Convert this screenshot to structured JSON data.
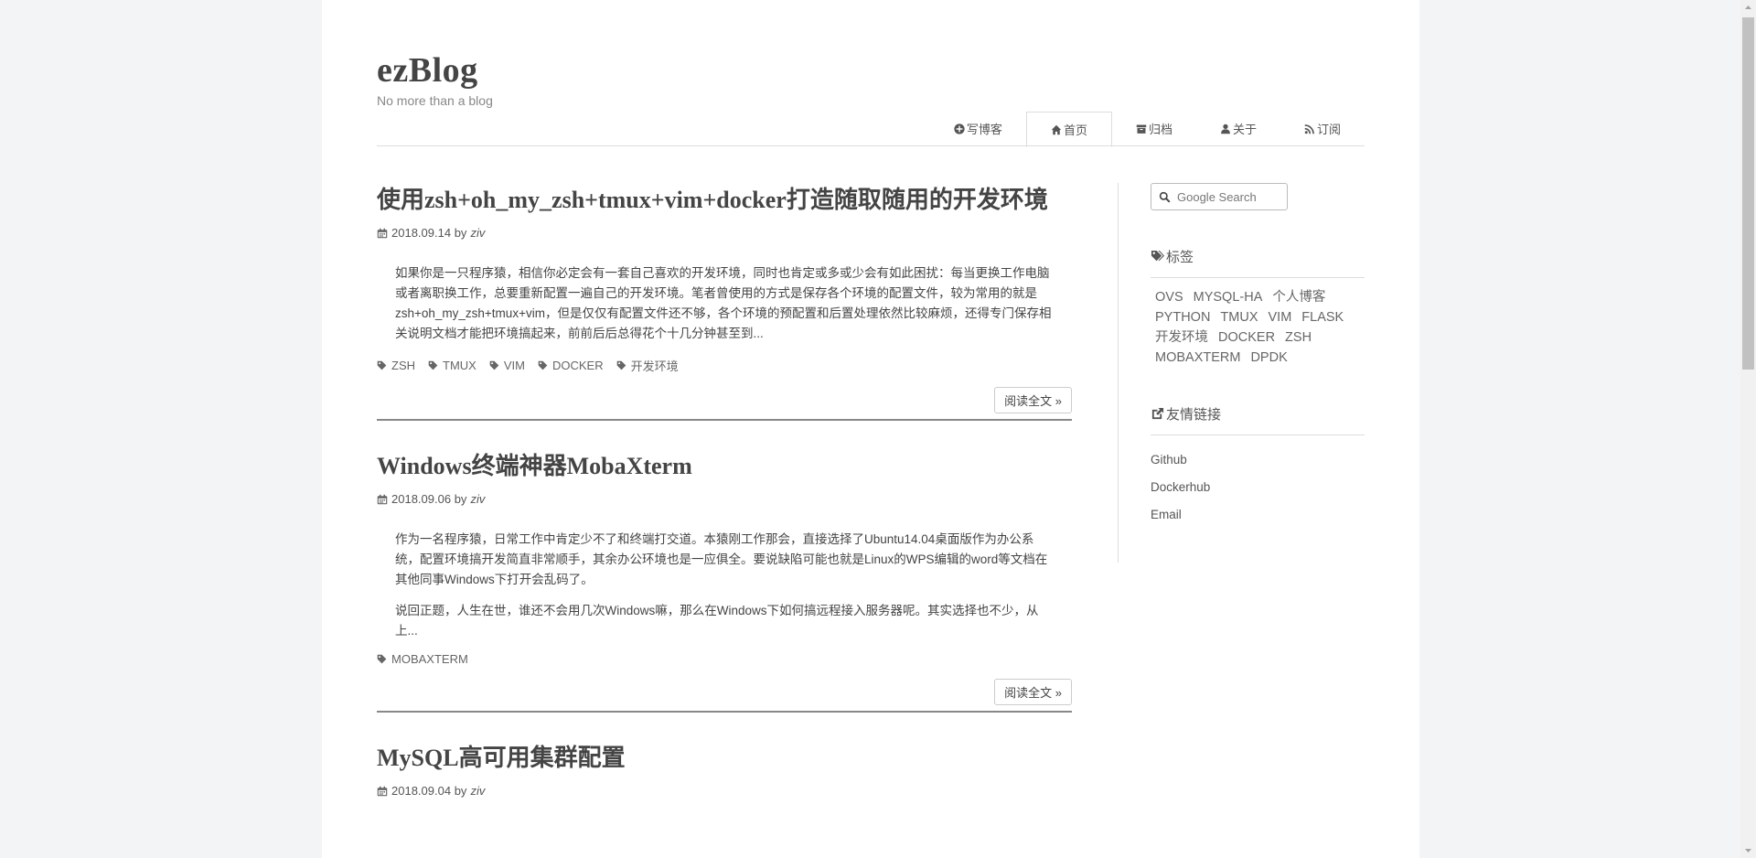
{
  "site": {
    "title": "ezBlog",
    "subtitle": "No more than a blog"
  },
  "nav": [
    {
      "label": "写博客",
      "icon": "plus-circle-icon",
      "active": false
    },
    {
      "label": "首页",
      "icon": "home-icon",
      "active": true
    },
    {
      "label": "归档",
      "icon": "archive-icon",
      "active": false
    },
    {
      "label": "关于",
      "icon": "user-icon",
      "active": false
    },
    {
      "label": "订阅",
      "icon": "rss-icon",
      "active": false
    }
  ],
  "posts": [
    {
      "title": "使用zsh+oh_my_zsh+tmux+vim+docker打造随取随用的开发环境",
      "date": "2018.09.14",
      "by": "by",
      "author": "ziv",
      "excerpt": [
        "如果你是一只程序猿，相信你必定会有一套自己喜欢的开发环境，同时也肯定或多或少会有如此困扰：每当更换工作电脑或者离职换工作，总要重新配置一遍自己的开发环境。笔者曾使用的方式是保存各个环境的配置文件，较为常用的就是zsh+oh_my_zsh+tmux+vim，但是仅仅有配置文件还不够，各个环境的预配置和后置处理依然比较麻烦，还得专门保存相关说明文档才能把环境搞起来，前前后后总得花个十几分钟甚至到..."
      ],
      "tags": [
        "ZSH",
        "TMUX",
        "VIM",
        "DOCKER",
        "开发环境"
      ],
      "read_more": "阅读全文 »"
    },
    {
      "title": "Windows终端神器MobaXterm",
      "date": "2018.09.06",
      "by": "by",
      "author": "ziv",
      "excerpt": [
        "作为一名程序猿，日常工作中肯定少不了和终端打交道。本猿刚工作那会，直接选择了Ubuntu14.04桌面版作为办公系统，配置环境搞开发简直非常顺手，其余办公环境也是一应俱全。要说缺陷可能也就是Linux的WPS编辑的word等文档在其他同事Windows下打开会乱码了。",
        "说回正题，人生在世，谁还不会用几次Windows嘛，那么在Windows下如何搞远程接入服务器呢。其实选择也不少，从上..."
      ],
      "tags": [
        "MOBAXTERM"
      ],
      "read_more": "阅读全文 »"
    },
    {
      "title": "MySQL高可用集群配置",
      "date": "2018.09.04",
      "by": "by",
      "author": "ziv"
    }
  ],
  "sidebar": {
    "search_placeholder": "Google Search",
    "tags_title": "标签",
    "tags": [
      "OVS",
      "MYSQL-HA",
      "个人博客",
      "PYTHON",
      "TMUX",
      "VIM",
      "FLASK",
      "开发环境",
      "DOCKER",
      "ZSH",
      "MOBAXTERM",
      "DPDK"
    ],
    "links_title": "友情链接",
    "links": [
      "Github",
      "Dockerhub",
      "Email"
    ]
  }
}
